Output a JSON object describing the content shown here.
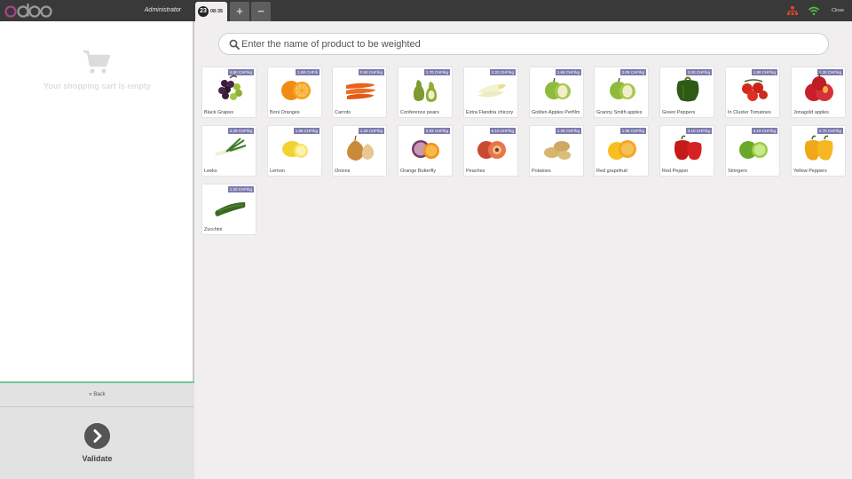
{
  "header": {
    "brand": "odoo",
    "user": "Administrator",
    "order": {
      "number": "23",
      "time": "08:35"
    },
    "add_label": "+",
    "remove_label": "−",
    "close_label": "Close",
    "status_icons": [
      "network-icon",
      "wifi-icon"
    ]
  },
  "cart": {
    "empty_message": "Your shopping cart is empty",
    "icon": "shopping-cart-icon"
  },
  "actions": {
    "back_label": "« Back",
    "validate_label": "Validate"
  },
  "search": {
    "placeholder": "Enter the name of product to be weighted",
    "value": ""
  },
  "colors": {
    "topbar": "#393939",
    "price_tag": "#7c7bad",
    "accent": "#6ec89b"
  },
  "products": [
    {
      "name": "Black Grapes",
      "price": "4.80 CHF/kg",
      "icon": "grapes"
    },
    {
      "name": "Boni Oranges",
      "price": "1.98 CHF/k",
      "icon": "orange"
    },
    {
      "name": "Carrots",
      "price": "0.90 CHF/kg",
      "icon": "carrot"
    },
    {
      "name": "Conference pears",
      "price": "1.70 CHF/kg",
      "icon": "pear"
    },
    {
      "name": "Extra Flandria chicory",
      "price": "2.20 CHF/kg",
      "icon": "chicory"
    },
    {
      "name": "Golden Apples Perfilm",
      "price": "1.69 CHF/kg",
      "icon": "green-apple"
    },
    {
      "name": "Granny Smith apples",
      "price": "2.09 CHF/kg",
      "icon": "green-apple"
    },
    {
      "name": "Green Peppers",
      "price": "3.00 CHF/kg",
      "icon": "green-pepper"
    },
    {
      "name": "In Cluster Tomatoes",
      "price": "1.90 CHF/kg",
      "icon": "tomato"
    },
    {
      "name": "Jonagold apples",
      "price": "1.30 CHF/kg",
      "icon": "red-apple"
    },
    {
      "name": "Leeks",
      "price": "2.29 CHF/kg",
      "icon": "leek"
    },
    {
      "name": "Lemon",
      "price": "1.98 CHF/kg",
      "icon": "lemon"
    },
    {
      "name": "Onions",
      "price": "1.28 CHF/kg",
      "icon": "onion"
    },
    {
      "name": "Orange Butterfly",
      "price": "2.83 CHF/kg",
      "icon": "orange-cut"
    },
    {
      "name": "Peaches",
      "price": "5.10 CHF/kg",
      "icon": "peach"
    },
    {
      "name": "Potatoes",
      "price": "1.39 CHF/kg",
      "icon": "potato"
    },
    {
      "name": "Red grapefruit",
      "price": "1.98 CHF/kg",
      "icon": "grapefruit"
    },
    {
      "name": "Red Pepper",
      "price": "3.10 CHF/kg",
      "icon": "red-pepper"
    },
    {
      "name": "Stringers",
      "price": "3.19 CHF/kg",
      "icon": "lime"
    },
    {
      "name": "Yellow Peppers",
      "price": "2.70 CHF/kg",
      "icon": "yellow-pepper"
    },
    {
      "name": "Zucchini",
      "price": "1.20 CHF/kg",
      "icon": "zucchini"
    }
  ]
}
